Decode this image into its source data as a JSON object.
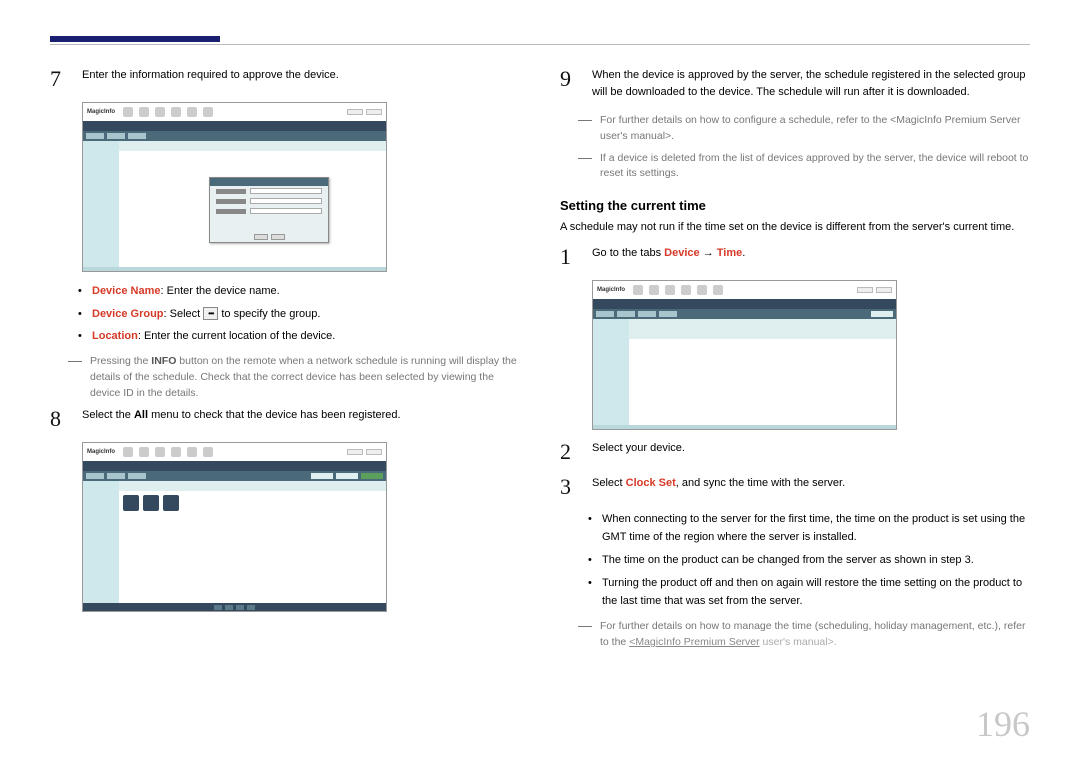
{
  "page_number": "196",
  "left": {
    "step7": {
      "num": "7",
      "text": "Enter the information required to approve the device."
    },
    "screenshot1_logo": "MagicInfo",
    "bullets1": {
      "b1": {
        "label": "Device Name",
        "text": ": Enter the device name."
      },
      "b2": {
        "label": "Device Group",
        "pre": ": Select ",
        "post": " to specify the group."
      },
      "b3": {
        "label": "Location",
        "text": ": Enter the current location of the device."
      }
    },
    "note1": {
      "pre": "Pressing the ",
      "bold": "INFO",
      "post": " button on the remote when a network schedule is running will display the details of the schedule. Check that the correct device has been selected by viewing the device ID in the details."
    },
    "step8": {
      "num": "8",
      "pre": "Select the ",
      "bold": "All",
      "post": " menu to check that the device has been registered."
    }
  },
  "right": {
    "step9": {
      "num": "9",
      "text": "When the device is approved by the server, the schedule registered in the selected group will be downloaded to the device. The schedule will run after it is downloaded."
    },
    "note_a": "For further details on how to configure a schedule, refer to the <MagicInfo Premium Server user's manual>.",
    "note_b": "If a device is deleted from the list of devices approved by the server, the device will reboot to reset its settings.",
    "section_title": "Setting the current time",
    "section_sub": "A schedule may not run if the time set on the device is different from the server's current time.",
    "step1": {
      "num": "1",
      "pre": "Go to the tabs ",
      "r1": "Device",
      "arrow": " → ",
      "r2": "Time",
      "period": "."
    },
    "screenshot3_logo": "MagicInfo",
    "step2": {
      "num": "2",
      "text": "Select your device."
    },
    "step3": {
      "num": "3",
      "pre": "Select ",
      "bold": "Clock Set",
      "post": ", and sync the time with the server."
    },
    "bullets2": {
      "b1": "When connecting to the server for the first time, the time on the product is set using the GMT time of the region where the server is installed.",
      "b2": "The time on the product can be changed from the server as shown in step 3.",
      "b3": "Turning the product off and then on again will restore the time setting on the product to the last time that was set from the server."
    },
    "note_c": {
      "pre": "For further details on how to manage the time (scheduling, holiday management, etc.), refer to the ",
      "link": "<MagicInfo Premium Server",
      "post": " user's manual>."
    }
  }
}
